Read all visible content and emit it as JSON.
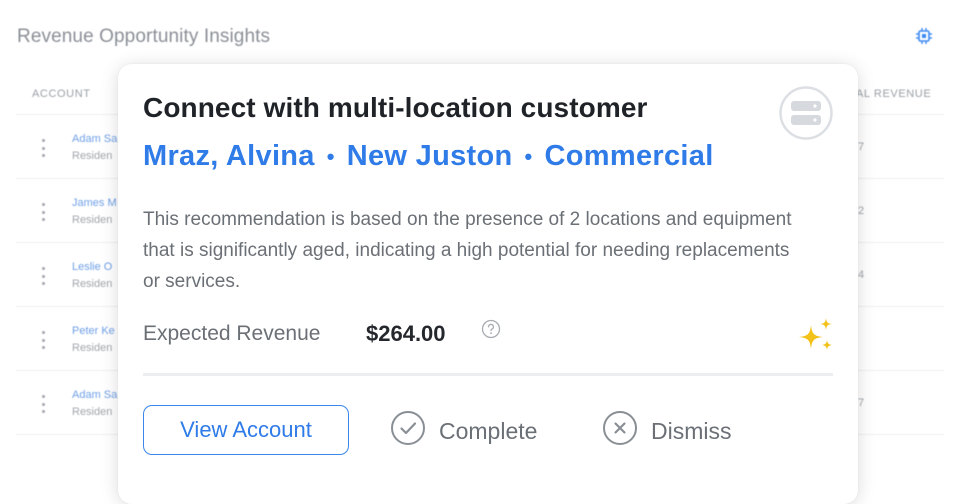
{
  "page": {
    "title": "Revenue Opportunity Insights",
    "header_account": "ACCOUNT",
    "header_revenue": "AL REVENUE",
    "rows": [
      {
        "name": "Adam Sa",
        "type": "Residen",
        "value": "7"
      },
      {
        "name": "James M",
        "type": "Residen",
        "value": "2"
      },
      {
        "name": "Leslie O",
        "type": "Residen",
        "value": "4"
      },
      {
        "name": "Peter Ke",
        "type": "Residen",
        "value": ""
      },
      {
        "name": "Adam Sa",
        "type": "Residen",
        "value": "7"
      }
    ]
  },
  "card": {
    "title": "Connect with multi-location customer",
    "customer": "Mraz, Alvina",
    "city": "New Juston",
    "segment": "Commercial",
    "separator": "•",
    "description": "This recommendation is based on the presence of 2 locations and equipment that is significantly aged, indicating a high potential for needing replacements or services.",
    "revenue_label": "Expected Revenue",
    "revenue_value": "$264.00",
    "view_account_label": "View Account",
    "complete_label": "Complete",
    "dismiss_label": "Dismiss"
  },
  "colors": {
    "accent": "#2f7be8",
    "sparkle": "#f2c21b",
    "muted_text": "#6b7076"
  },
  "icons": {
    "chip": "chip-icon",
    "server": "server-icon",
    "help": "help-circle-icon",
    "sparkle": "sparkle-icon",
    "complete": "check-circle-icon",
    "dismiss": "x-circle-icon"
  }
}
